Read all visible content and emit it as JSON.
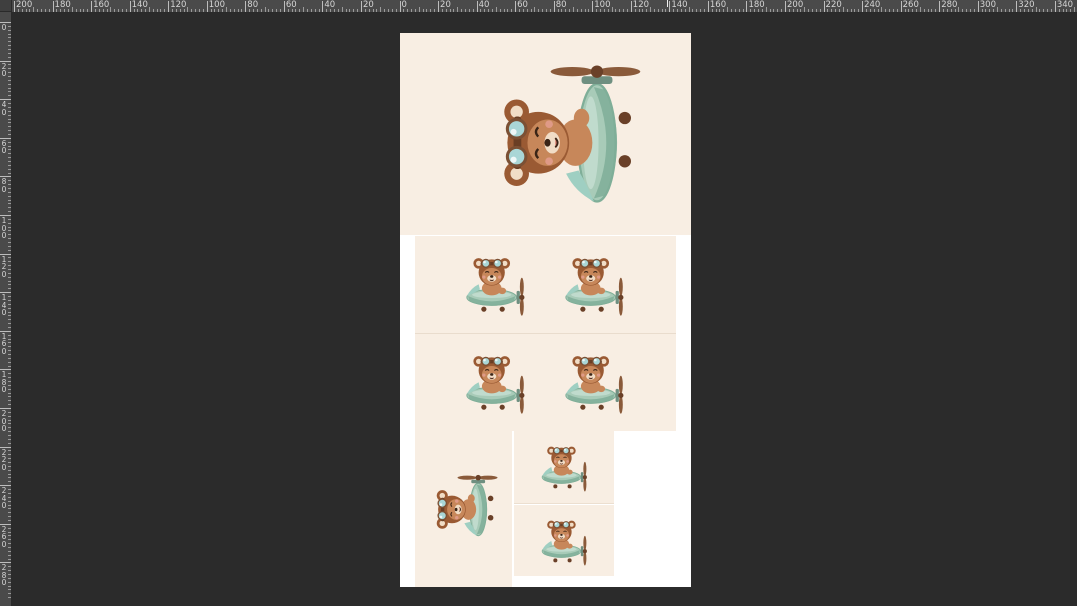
{
  "app": {
    "view": "image-editor-canvas"
  },
  "rulers": {
    "unit": "mm",
    "horizontal_labels": [
      "200",
      "180",
      "160",
      "140",
      "120",
      "100",
      "80",
      "60",
      "40",
      "20",
      "0",
      "20",
      "40",
      "60",
      "80",
      "100",
      "120",
      "140",
      "160",
      "180",
      "200",
      "220",
      "240",
      "260",
      "280",
      "300",
      "320",
      "340"
    ],
    "vertical_labels": [
      "0",
      "20",
      "40",
      "60",
      "80",
      "100",
      "120",
      "140",
      "160",
      "180",
      "200",
      "220",
      "240",
      "260",
      "280"
    ]
  },
  "canvas": {
    "background": "#ffffff",
    "panel_color": "#f8eee3",
    "workspace_color": "#2b2b2b"
  },
  "artwork": {
    "subject": "teddy bear pilot in green airplane",
    "panels": [
      {
        "id": "large-cover",
        "orientation": "rotated"
      },
      {
        "id": "row1-left"
      },
      {
        "id": "row1-right"
      },
      {
        "id": "row2-left"
      },
      {
        "id": "row2-right"
      },
      {
        "id": "bottom-left",
        "orientation": "rotated"
      },
      {
        "id": "small-top"
      },
      {
        "id": "small-bottom"
      }
    ],
    "colors": {
      "fur": "#c7875a",
      "fur_light": "#f1ddc6",
      "helmet": "#9a5a33",
      "goggle": "#a9d6d6",
      "plane": "#a8cbb8",
      "plane_dark": "#7fae98",
      "propeller": "#8a5a3a",
      "scarf": "#9fcfc2"
    }
  }
}
